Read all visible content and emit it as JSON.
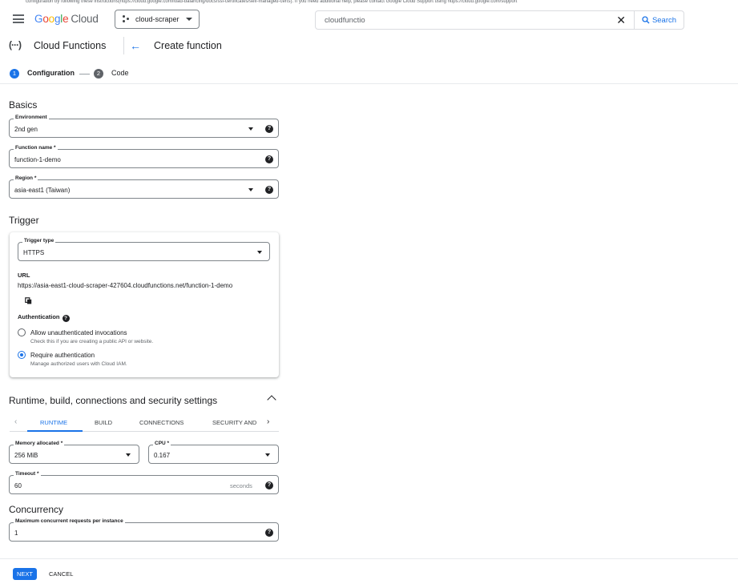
{
  "banner": "configuration by following these instructions(https://cloud.google.com/load-balancing/docs/ssl-certificates/self-managed-certs). If you need additional help, please contact Google Cloud Support using https://cloud.google.com/support",
  "topbar": {
    "logo_letters": [
      "G",
      "o",
      "o",
      "g",
      "l",
      "e"
    ],
    "logo_suffix": "Cloud",
    "project": "cloud-scraper",
    "search_value": "cloudfunctio",
    "search_button": "Search"
  },
  "header": {
    "product_icon": "(···)",
    "product": "Cloud Functions",
    "page_title": "Create function"
  },
  "stepper": {
    "steps": [
      {
        "num": "1",
        "label": "Configuration"
      },
      {
        "num": "2",
        "label": "Code"
      }
    ]
  },
  "basics": {
    "heading": "Basics",
    "environment": {
      "label": "Environment",
      "value": "2nd gen"
    },
    "function_name": {
      "label": "Function name *",
      "value": "function-1-demo"
    },
    "region": {
      "label": "Region *",
      "value": "asia-east1 (Taiwan)"
    }
  },
  "trigger": {
    "heading": "Trigger",
    "trigger_type": {
      "label": "Trigger type",
      "value": "HTTPS"
    },
    "url_label": "URL",
    "url": "https://asia-east1-cloud-scraper-427604.cloudfunctions.net/function-1-demo",
    "auth_label": "Authentication",
    "options": [
      {
        "label": "Allow unauthenticated invocations",
        "sub": "Check this if you are creating a public API or website.",
        "selected": false
      },
      {
        "label": "Require authentication",
        "sub": "Manage authorized users with Cloud IAM.",
        "selected": true
      }
    ]
  },
  "runtime": {
    "heading": "Runtime, build, connections and security settings",
    "tabs": [
      "RUNTIME",
      "BUILD",
      "CONNECTIONS",
      "SECURITY AND"
    ],
    "active_tab": "RUNTIME",
    "memory": {
      "label": "Memory allocated *",
      "value": "256 MiB"
    },
    "cpu": {
      "label": "CPU *",
      "value": "0.167"
    },
    "timeout": {
      "label": "Timeout *",
      "value": "60",
      "suffix": "seconds"
    }
  },
  "concurrency": {
    "heading": "Concurrency",
    "max_requests": {
      "label": "Maximum concurrent requests per instance",
      "value": "1"
    }
  },
  "footer": {
    "next": "NEXT",
    "cancel": "CANCEL"
  },
  "colors": {
    "accent": "#1a73e8",
    "text": "#202124",
    "border": "#80868b"
  }
}
